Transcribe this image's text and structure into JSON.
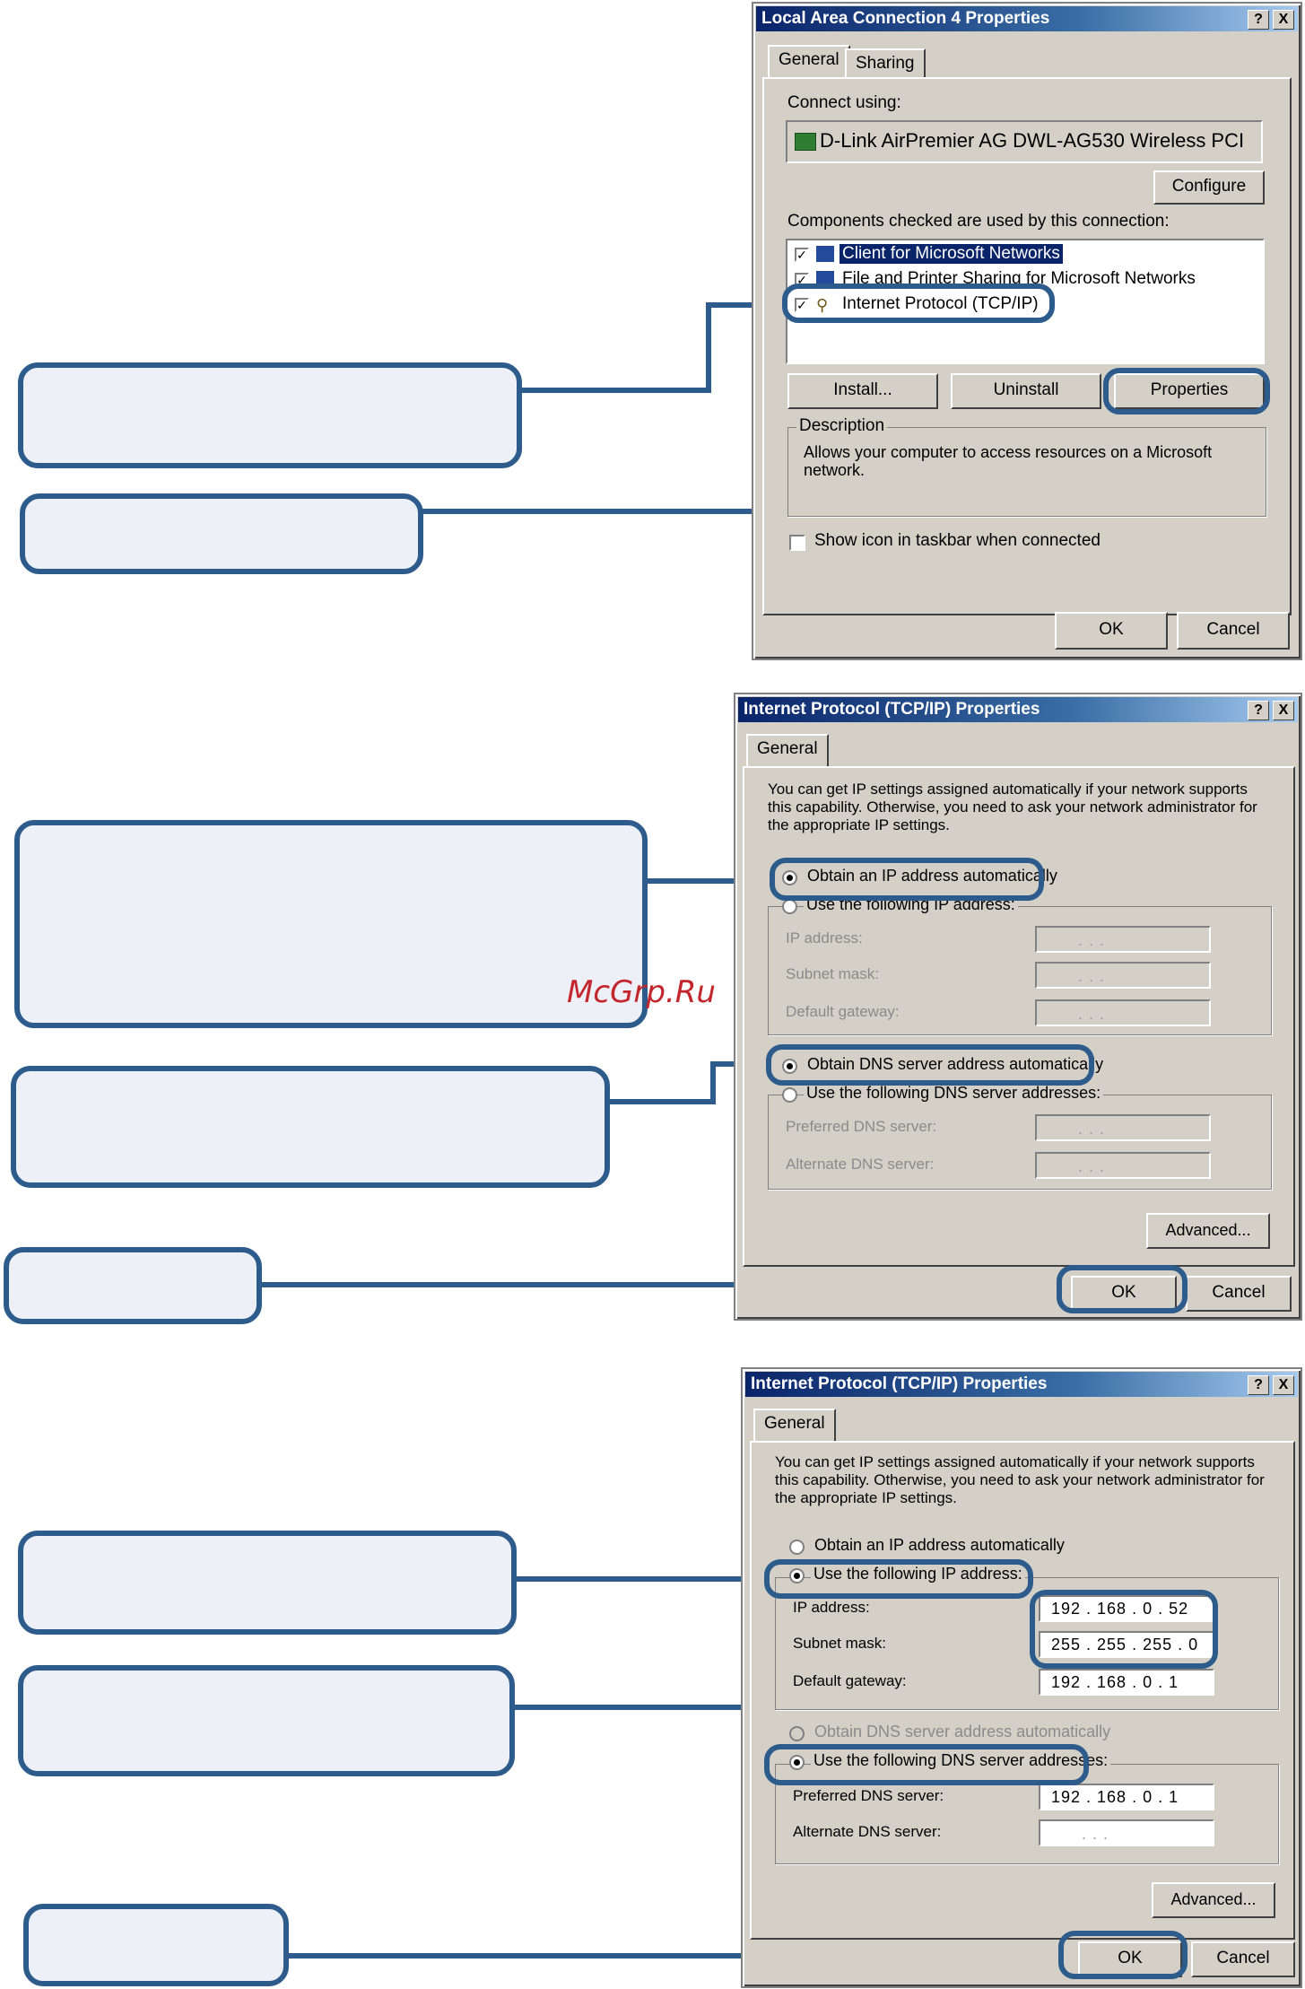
{
  "watermark": "McGrp.Ru",
  "lan": {
    "title": "Local Area Connection 4 Properties",
    "help": "?",
    "close": "X",
    "tabs": [
      "General",
      "Sharing"
    ],
    "connect_using_label": "Connect using:",
    "adapter": "D-Link AirPremier AG DWL-AG530 Wireless PCI",
    "configure": "Configure",
    "components_label": "Components checked are used by this connection:",
    "components": [
      "Client for Microsoft Networks",
      "File and Printer Sharing for Microsoft Networks",
      "Internet Protocol (TCP/IP)"
    ],
    "install": "Install...",
    "uninstall": "Uninstall",
    "properties": "Properties",
    "description_label": "Description",
    "description": "Allows your computer to access resources on a Microsoft network.",
    "show_icon": "Show icon in taskbar when connected",
    "ok": "OK",
    "cancel": "Cancel"
  },
  "tcp1": {
    "title": "Internet Protocol (TCP/IP) Properties",
    "help": "?",
    "close": "X",
    "tab": "General",
    "intro": "You can get IP settings assigned automatically if your network supports this capability. Otherwise, you need to ask your network administrator for the appropriate IP settings.",
    "obtain_ip": "Obtain an IP address automatically",
    "use_ip": "Use the following IP address:",
    "ip_label": "IP address:",
    "mask_label": "Subnet mask:",
    "gw_label": "Default gateway:",
    "obtain_dns": "Obtain DNS server address automatically",
    "use_dns": "Use the following DNS server addresses:",
    "pref_dns_label": "Preferred DNS server:",
    "alt_dns_label": "Alternate DNS server:",
    "empty_ip": ".      .      .",
    "advanced": "Advanced...",
    "ok": "OK",
    "cancel": "Cancel"
  },
  "tcp2": {
    "title": "Internet Protocol (TCP/IP) Properties",
    "help": "?",
    "close": "X",
    "tab": "General",
    "intro": "You can get IP settings assigned automatically if your network supports this capability. Otherwise, you need to ask your network administrator for the appropriate IP settings.",
    "obtain_ip": "Obtain an IP address automatically",
    "use_ip": "Use the following IP address:",
    "ip_label": "IP address:",
    "ip_value": "192 . 168 .   0   .  52",
    "mask_label": "Subnet mask:",
    "mask_value": "255 . 255 . 255 .   0",
    "gw_label": "Default gateway:",
    "gw_value": "192 . 168 .   0   .   1",
    "obtain_dns": "Obtain DNS server address automatically",
    "use_dns": "Use the following DNS server addresses:",
    "pref_dns_label": "Preferred DNS server:",
    "pref_dns_value": "192 . 168 .   0   .   1",
    "alt_dns_label": "Alternate DNS server:",
    "empty_ip": ".      .      .",
    "advanced": "Advanced...",
    "ok": "OK",
    "cancel": "Cancel"
  },
  "colors": {
    "callout_border": "#2d5b8c",
    "callout_fill": "#eef0f8",
    "dialog_bg": "#d4d0c8",
    "titlebar": "#0a246a"
  }
}
